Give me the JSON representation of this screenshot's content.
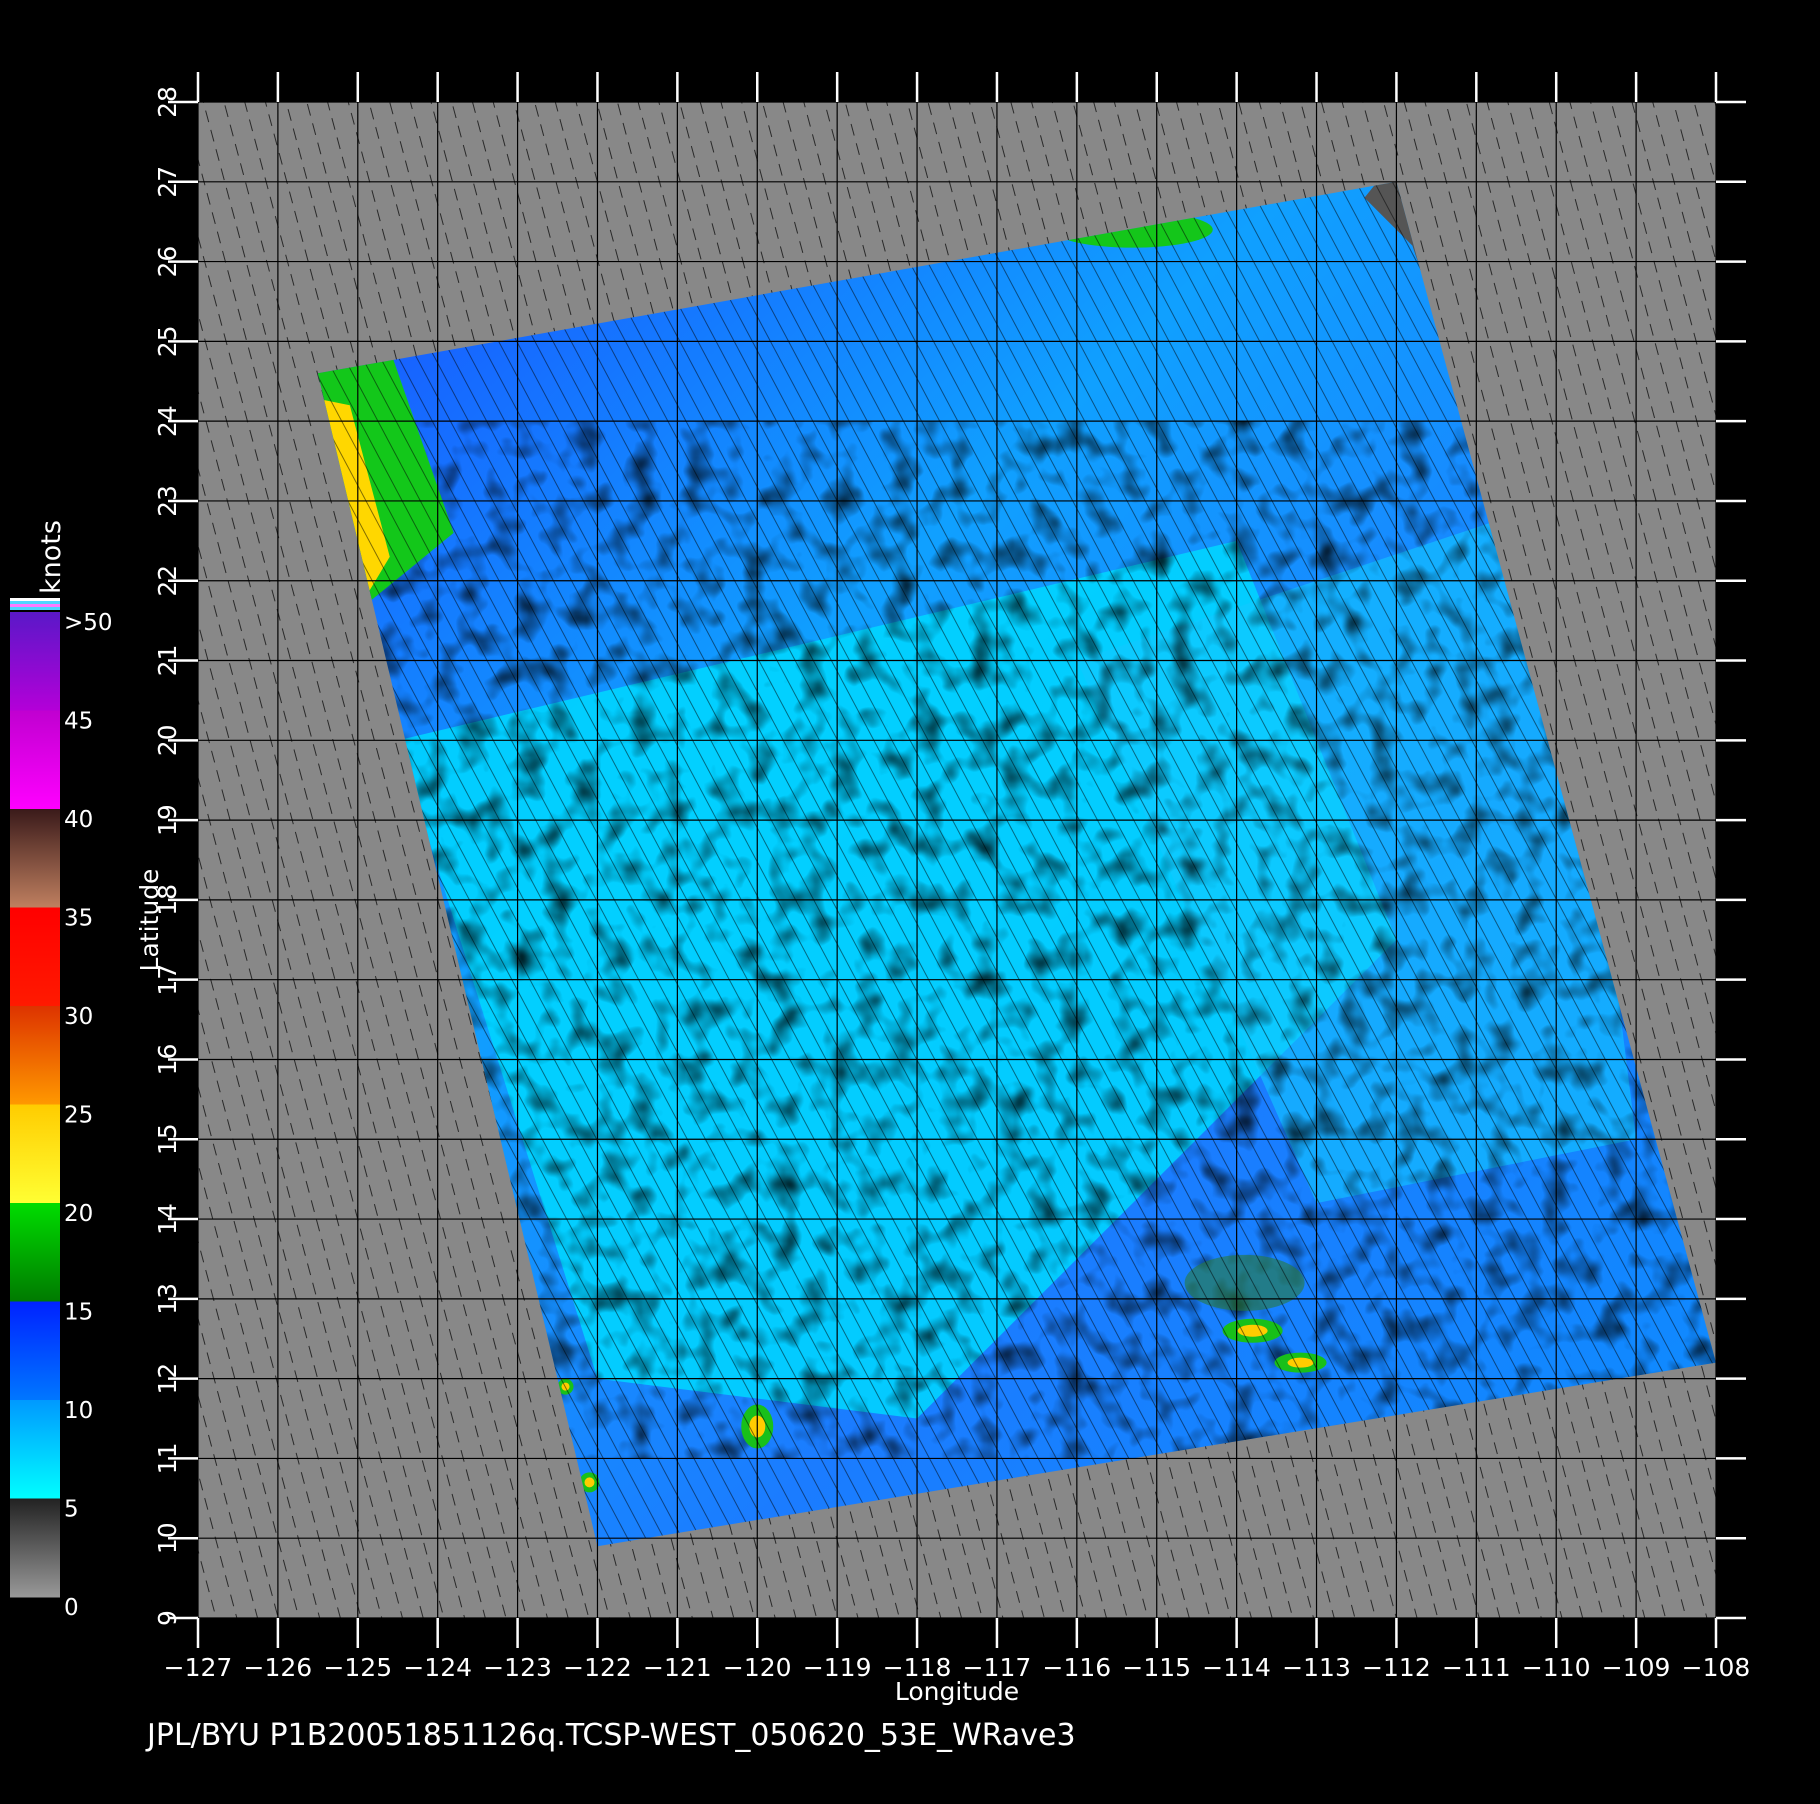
{
  "plot": {
    "xlabel": "Longitude",
    "ylabel": "Latitude",
    "lon_range": [
      -127,
      -108
    ],
    "lat_range": [
      9,
      28
    ],
    "lon_ticks": [
      "-127",
      "-126",
      "-125",
      "-124",
      "-123",
      "-122",
      "-121",
      "-120",
      "-119",
      "-118",
      "-117",
      "-116",
      "-115",
      "-114",
      "-113",
      "-112",
      "-111",
      "-110",
      "-109",
      "-108"
    ],
    "lat_ticks": [
      "9",
      "10",
      "11",
      "12",
      "13",
      "14",
      "15",
      "16",
      "17",
      "18",
      "19",
      "20",
      "21",
      "22",
      "23",
      "24",
      "25",
      "26",
      "27",
      "28"
    ],
    "background_color": "#888888",
    "swath_corners_lonlat": [
      [
        -125.5,
        24.6
      ],
      [
        -112.0,
        27.0
      ],
      [
        -108.0,
        12.2
      ],
      [
        -122.0,
        9.9
      ]
    ],
    "land_color": "#555555"
  },
  "colorbar": {
    "title": "knots",
    "labels": [
      ">50",
      "45",
      "40",
      "35",
      "30",
      "25",
      "20",
      "15",
      "10",
      "5",
      "0"
    ],
    "bands": [
      {
        "from": 50,
        "to": 45,
        "top": "#5a18c8",
        "bottom": "#b400d8"
      },
      {
        "from": 45,
        "to": 40,
        "top": "#c000d0",
        "bottom": "#ff00ff"
      },
      {
        "from": 40,
        "to": 35,
        "top": "#3a1a1a",
        "bottom": "#c08060"
      },
      {
        "from": 35,
        "to": 30,
        "top": "#ff0000",
        "bottom": "#ff1a00"
      },
      {
        "from": 30,
        "to": 25,
        "top": "#dd3300",
        "bottom": "#ff9900"
      },
      {
        "from": 25,
        "to": 20,
        "top": "#ffcc00",
        "bottom": "#ffff33"
      },
      {
        "from": 20,
        "to": 15,
        "top": "#00dd00",
        "bottom": "#007a00"
      },
      {
        "from": 15,
        "to": 10,
        "top": "#0022ff",
        "bottom": "#0077ff"
      },
      {
        "from": 10,
        "to": 5,
        "top": "#0099ff",
        "bottom": "#00ffff"
      },
      {
        "from": 5,
        "to": 0,
        "top": "#222222",
        "bottom": "#999999"
      }
    ]
  },
  "footer": "JPL/BYU  P1B20051851126q.TCSP-WEST_050620_53E_WRave3"
}
